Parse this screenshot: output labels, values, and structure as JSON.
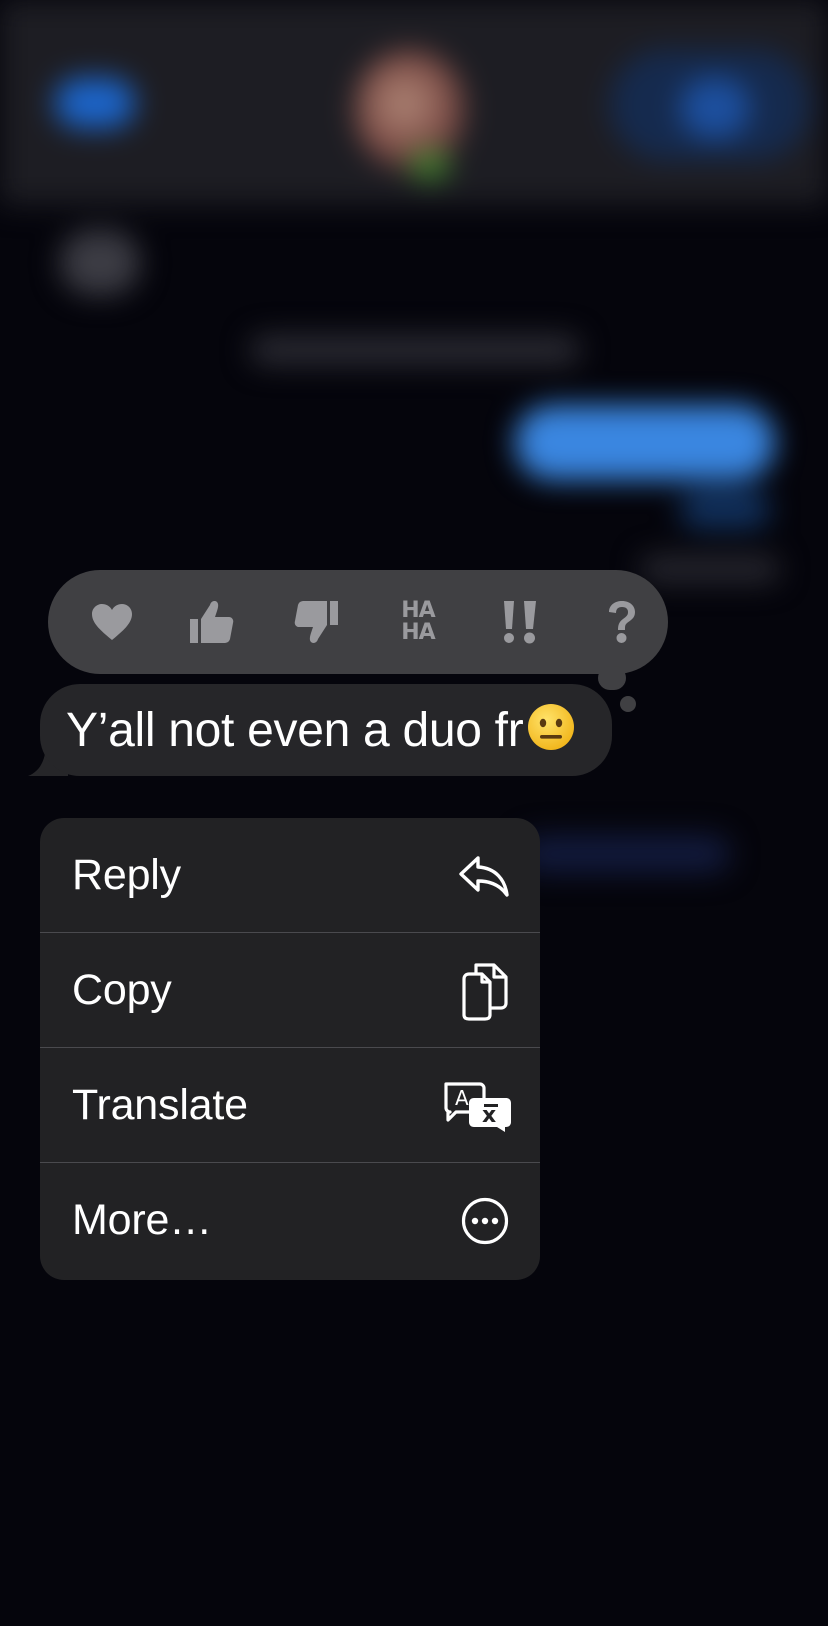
{
  "message": {
    "text": "Y’all not even a duo fr",
    "emoji": "neutral-face"
  },
  "tapbacks": [
    {
      "name": "heart",
      "icon": "heart-icon"
    },
    {
      "name": "thumbs-up",
      "icon": "thumbs-up-icon"
    },
    {
      "name": "thumbs-down",
      "icon": "thumbs-down-icon"
    },
    {
      "name": "haha",
      "icon": "haha-icon",
      "line1": "HA",
      "line2": "HA"
    },
    {
      "name": "emphasize",
      "icon": "double-exclamation-icon"
    },
    {
      "name": "question",
      "icon": "question-mark-icon"
    }
  ],
  "menu": {
    "items": [
      {
        "label": "Reply",
        "icon": "reply-arrow-icon"
      },
      {
        "label": "Copy",
        "icon": "copy-documents-icon"
      },
      {
        "label": "Translate",
        "icon": "translate-icon"
      },
      {
        "label": "More…",
        "icon": "more-ellipsis-icon"
      }
    ]
  },
  "colors": {
    "background": "#05050c",
    "tapback_bar": "#404043",
    "tapback_icon": "#9a9a9e",
    "bubble": "#262629",
    "menu": "#222224",
    "separator": "#4a4a4e",
    "text": "#ffffff"
  }
}
